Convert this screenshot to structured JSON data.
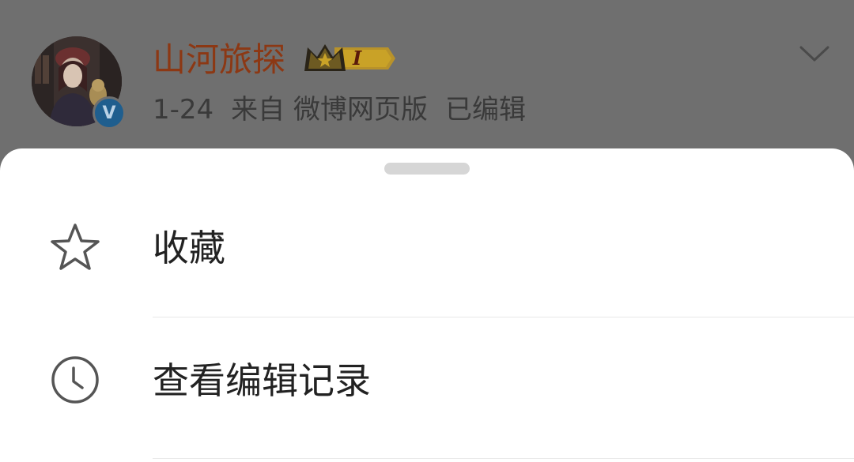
{
  "post_header": {
    "username": "山河旅探",
    "level_badge": "I",
    "verified_badge": "V",
    "meta": {
      "date": "1-24",
      "source": "来自 微博网页版",
      "edited": "已编辑"
    },
    "icons": {
      "avatar": "avatar-image",
      "crown": "crown-icon",
      "expand": "chevron-down-icon"
    }
  },
  "sheet": {
    "items": [
      {
        "label": "收藏",
        "icon": "star-icon"
      },
      {
        "label": "查看编辑记录",
        "icon": "clock-icon"
      }
    ]
  },
  "colors": {
    "username": "#8c3814",
    "overlay": "#6f6f6f",
    "sheet_bg": "#ffffff",
    "menu_text": "#222222",
    "icon_stroke": "#555555",
    "crown_gold": "#c9a227",
    "verified_blue": "#1f5e8e"
  }
}
